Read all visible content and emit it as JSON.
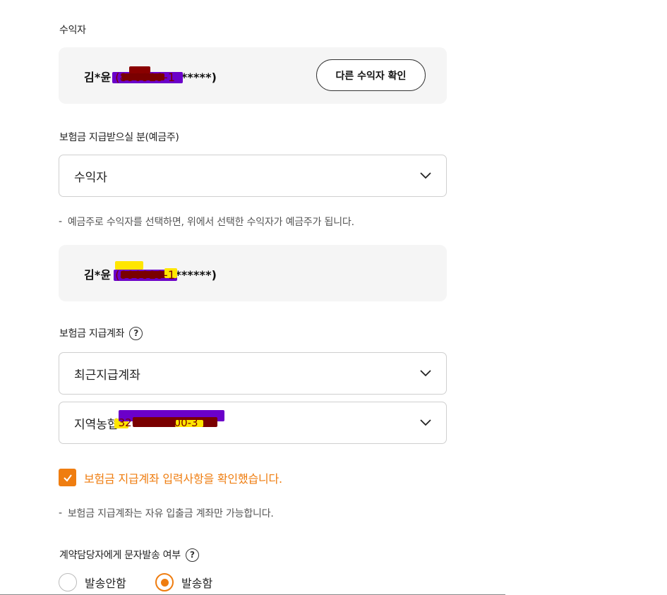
{
  "beneficiary": {
    "label": "수익자",
    "masked_name_prefix": "김*윤 ",
    "masked_id": "(890929-1",
    "masked_suffix": "******)",
    "other_button": "다른 수익자 확인"
  },
  "depositor": {
    "label": "보험금 지급받으실 분(예금주)",
    "selected": "수익자",
    "note_dash": "-",
    "note": "예금주로 수익자를 선택하면, 위에서 선택한 수익자가 예금주가 됩니다.",
    "masked_name_prefix": "김*윤 ",
    "masked_id": "(890929-1",
    "masked_suffix": "******)"
  },
  "account": {
    "label": "보험금 지급계좌",
    "help": "?",
    "type_selected": "최근지급계좌",
    "bank_prefix": "지역농협",
    "bank_masked": " 326-****-300-3",
    "confirm_checkbox": "보험금 지급계좌 입력사항을 확인했습니다.",
    "note_dash": "-",
    "note": "보험금 지급계좌는 자유 입출금 계좌만 가능합니다."
  },
  "sms": {
    "label": "계약담당자에게 문자발송 여부",
    "help": "?",
    "options": [
      {
        "label": "발송안함",
        "selected": false
      },
      {
        "label": "발송함",
        "selected": true
      }
    ]
  },
  "colors": {
    "accent": "#ef7d10",
    "mask_purple": "#6b00c9",
    "mask_yellow": "#ffe600",
    "mask_red": "#7a0000"
  }
}
